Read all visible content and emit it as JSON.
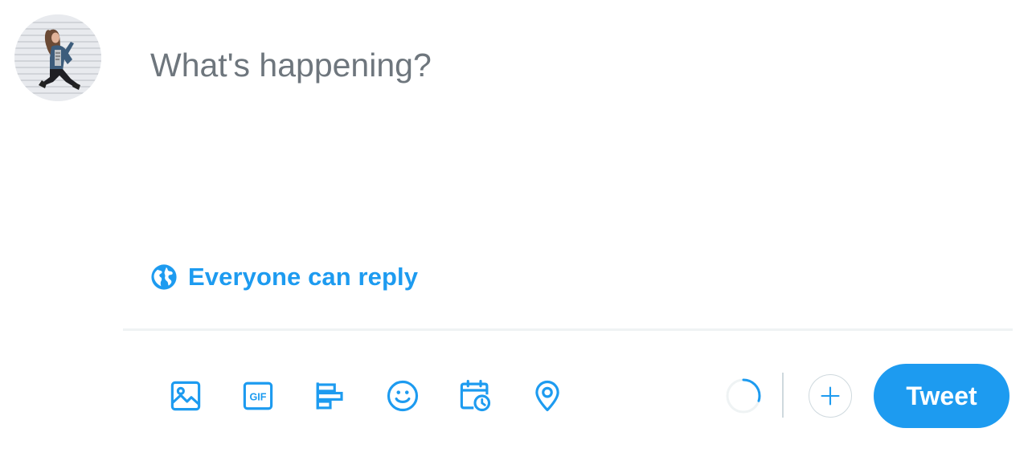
{
  "composer": {
    "placeholder": "What's happening?",
    "reply_setting_label": "Everyone can reply",
    "tweet_button_label": "Tweet",
    "character_progress": 0.3
  },
  "toolbar": {
    "icons": [
      "media-icon",
      "gif-icon",
      "poll-icon",
      "emoji-icon",
      "schedule-icon",
      "location-icon",
      "add-thread-icon"
    ]
  },
  "colors": {
    "accent": "#1d9bf0",
    "placeholder_text": "#6e767d",
    "divider": "#eff3f4",
    "border": "#cfd9de"
  }
}
